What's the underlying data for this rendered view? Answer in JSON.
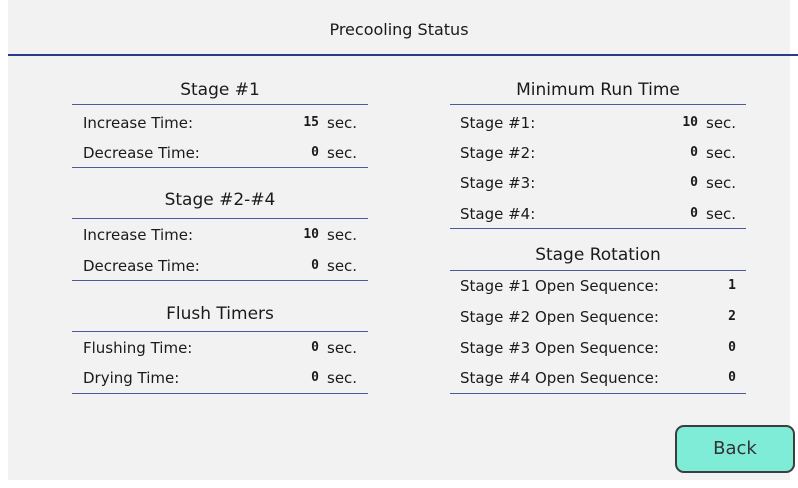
{
  "header": {
    "title": "Precooling Status"
  },
  "stage1": {
    "heading": "Stage #1",
    "increase_label": "Increase Time:",
    "increase_value": "15",
    "increase_unit": "sec.",
    "decrease_label": "Decrease Time:",
    "decrease_value": "0",
    "decrease_unit": "sec."
  },
  "stage2_4": {
    "heading": "Stage #2-#4",
    "increase_label": "Increase Time:",
    "increase_value": "10",
    "increase_unit": "sec.",
    "decrease_label": "Decrease Time:",
    "decrease_value": "0",
    "decrease_unit": "sec."
  },
  "flush": {
    "heading": "Flush Timers",
    "flushing_label": "Flushing Time:",
    "flushing_value": "0",
    "flushing_unit": "sec.",
    "drying_label": "Drying Time:",
    "drying_value": "0",
    "drying_unit": "sec."
  },
  "min_run": {
    "heading": "Minimum Run Time",
    "items": [
      {
        "label": "Stage #1:",
        "value": "10",
        "unit": "sec."
      },
      {
        "label": "Stage #2:",
        "value": "0",
        "unit": "sec."
      },
      {
        "label": "Stage #3:",
        "value": "0",
        "unit": "sec."
      },
      {
        "label": "Stage #4:",
        "value": "0",
        "unit": "sec."
      }
    ]
  },
  "rotation": {
    "heading": "Stage Rotation",
    "items": [
      {
        "label": "Stage #1 Open Sequence:",
        "value": "1"
      },
      {
        "label": "Stage #2 Open Sequence:",
        "value": "2"
      },
      {
        "label": "Stage #3 Open Sequence:",
        "value": "0"
      },
      {
        "label": "Stage #4 Open Sequence:",
        "value": "0"
      }
    ]
  },
  "actions": {
    "back_label": "Back"
  },
  "colors": {
    "title_rule": "#2b3a8a",
    "section_rule": "#4a5a9a",
    "back_button": "#7eecd6",
    "panel_background": "#f2f2f2"
  }
}
